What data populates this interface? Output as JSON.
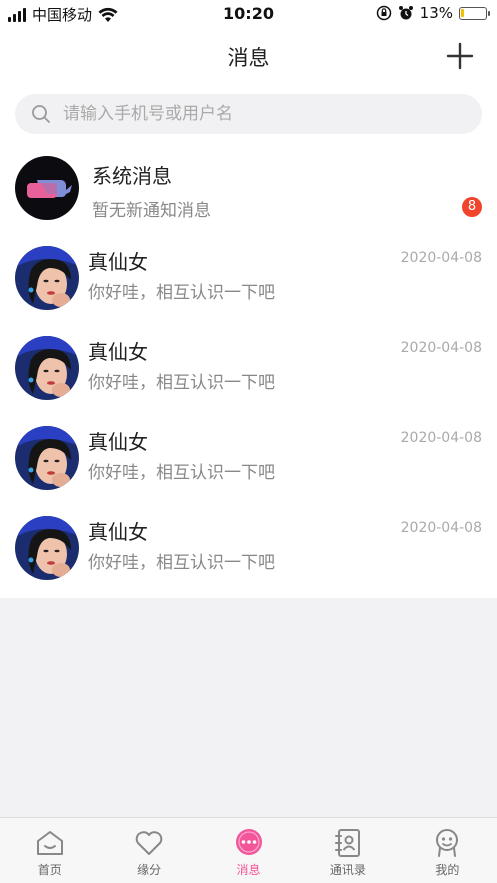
{
  "status_bar": {
    "carrier": "中国移动",
    "time": "10:20",
    "battery_percent": "13%",
    "battery_level": 0.13
  },
  "header": {
    "title": "消息",
    "add_icon": "plus-icon"
  },
  "search": {
    "placeholder": "请输入手机号或用户名",
    "icon": "search-icon"
  },
  "system_message": {
    "title": "系统消息",
    "preview": "暂无新通知消息",
    "unread_count": "8"
  },
  "conversations": [
    {
      "name": "真仙女",
      "preview": "你好哇，相互认识一下吧",
      "date": "2020-04-08"
    },
    {
      "name": "真仙女",
      "preview": "你好哇，相互认识一下吧",
      "date": "2020-04-08"
    },
    {
      "name": "真仙女",
      "preview": "你好哇，相互认识一下吧",
      "date": "2020-04-08"
    },
    {
      "name": "真仙女",
      "preview": "你好哇，相互认识一下吧",
      "date": "2020-04-08"
    }
  ],
  "tabs": [
    {
      "label": "首页",
      "icon": "home-icon"
    },
    {
      "label": "缘分",
      "icon": "heart-icon"
    },
    {
      "label": "消息",
      "icon": "chat-bubble-icon",
      "active": true
    },
    {
      "label": "通讯录",
      "icon": "contacts-book-icon"
    },
    {
      "label": "我的",
      "icon": "profile-face-icon"
    }
  ],
  "colors": {
    "accent": "#f2559a",
    "badge": "#f0442c",
    "background": "#f2f2f4"
  }
}
